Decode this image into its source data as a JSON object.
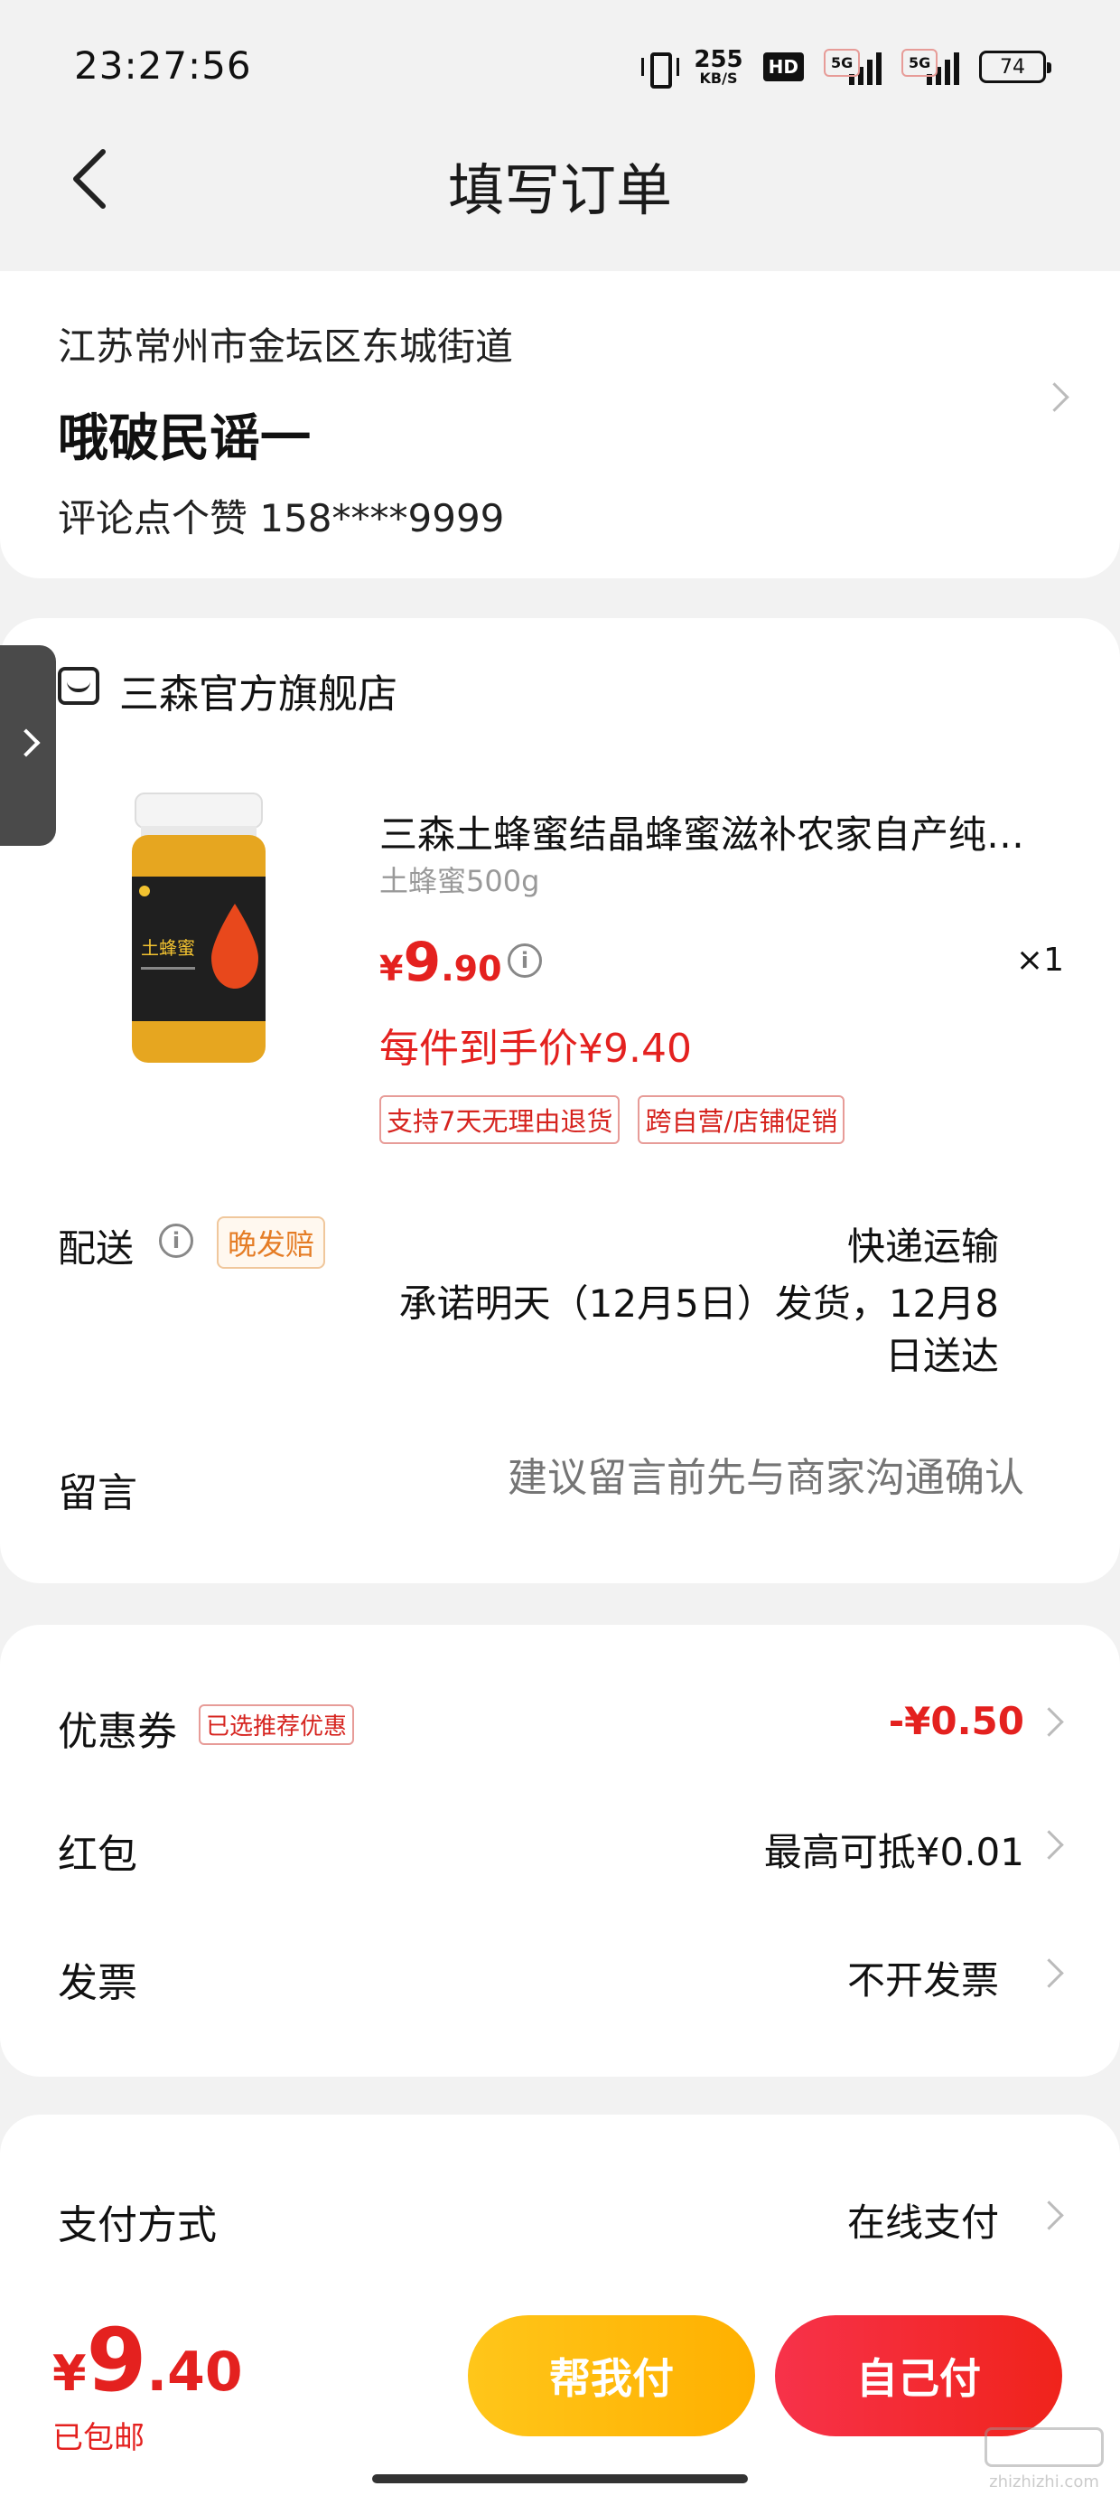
{
  "status_bar": {
    "time": "23:27:56",
    "net_speed": "255",
    "net_speed_unit": "KB/S",
    "hd_label": "HD",
    "signal_1_tag": "5G",
    "signal_2_tag": "5G",
    "battery": "74"
  },
  "header": {
    "title": "填写订单"
  },
  "address": {
    "line": "江苏常州市金坛区东城街道",
    "name": "哦破民谣一",
    "contact": "评论点个赞  158****9999"
  },
  "shop": {
    "name": "三森官方旗舰店"
  },
  "product": {
    "title": "三森土蜂蜜结晶蜂蜜滋补农家自产纯正天然",
    "spec": "土蜂蜜500g",
    "price_currency": "¥",
    "price_int": "9",
    "price_dec": ".90",
    "quantity": "×1",
    "final_price": "每件到手价¥9.40",
    "tags": [
      "支持7天无理由退货",
      "跨自营/店铺促销"
    ],
    "jar_label": "土蜂蜜"
  },
  "shipping": {
    "label": "配送",
    "late_badge": "晚发赔",
    "method": "快递运输",
    "promise": "承诺明天（12月5日）发货，12月8日送达"
  },
  "message": {
    "label": "留言",
    "placeholder": "建议留言前先与商家沟通确认"
  },
  "discounts": {
    "coupon_label": "优惠券",
    "coupon_badge": "已选推荐优惠",
    "coupon_value": "-¥0.50",
    "red_packet_label": "红包",
    "red_packet_value": "最高可抵¥0.01",
    "invoice_label": "发票",
    "invoice_value": "不开发票"
  },
  "payment": {
    "label": "支付方式",
    "value": "在线支付"
  },
  "footer": {
    "total_currency": "¥",
    "total_int": "9",
    "total_dec": ".40",
    "free_shipping": "已包邮",
    "friend_pay_button": "帮我付",
    "self_pay_button": "自己付"
  },
  "colors": {
    "accent_red": "#e4211f",
    "friend_button": "#ffb800",
    "self_button": "#f0231b"
  }
}
